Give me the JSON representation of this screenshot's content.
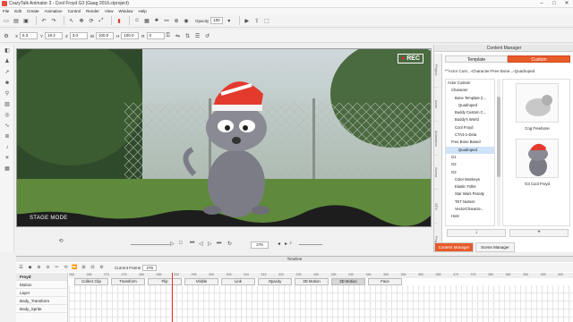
{
  "window": {
    "title": "CrazyTalk Animator 3 - Cool Froyd G3 (Gaag 2016.ctproject)"
  },
  "menu": [
    "File",
    "Edit",
    "Create",
    "Animation",
    "Control",
    "Render",
    "View",
    "Window",
    "Help"
  ],
  "toolbar": {
    "opacity_label": "Opacity",
    "opacity_value": "100"
  },
  "transform": {
    "x_label": "X",
    "x_value": "6.3",
    "y_label": "Y",
    "y_value": "19.2",
    "z_label": "Z",
    "z_value": "3.0",
    "w_label": "W",
    "w_value": "100.0",
    "h_label": "H",
    "h_value": "100.0",
    "r_label": "R",
    "r_value": "0"
  },
  "stage": {
    "rec_label": "REC",
    "mode_label": "STAGE MODE"
  },
  "playback": {
    "current_frame": "276"
  },
  "content_manager": {
    "title": "Content Manager",
    "tabs": [
      "Template",
      "Custom"
    ],
    "active_tab": "Custom",
    "side_tabs": [
      "Project",
      "Actor",
      "Animation",
      "Scene",
      "SFX",
      "Prop"
    ],
    "path": [
      "Actor Cust...",
      "Character",
      "Free Bone...",
      "Quadruped"
    ],
    "tree": [
      {
        "label": "Actor Custom",
        "indent": 0
      },
      {
        "label": "Character",
        "indent": 1
      },
      {
        "label": "Bone Template (I...",
        "indent": 2
      },
      {
        "label": "Quadruped",
        "indent": 3
      },
      {
        "label": "Buddy Custom C...",
        "indent": 2
      },
      {
        "label": "Buddy's World",
        "indent": 2
      },
      {
        "label": "Cool Froyd",
        "indent": 2
      },
      {
        "label": "CTA3-1-Deta",
        "indent": 2
      },
      {
        "label": "Free Bone Based",
        "indent": 1
      },
      {
        "label": "Quadruped",
        "indent": 3,
        "selected": true
      },
      {
        "label": "G1",
        "indent": 1
      },
      {
        "label": "G2",
        "indent": 1
      },
      {
        "label": "G3",
        "indent": 1
      },
      {
        "label": "Color Monkeys",
        "indent": 2
      },
      {
        "label": "Elastic Folks",
        "indent": 2
      },
      {
        "label": "Star Wars Parody",
        "indent": 2
      },
      {
        "label": "TET Nutters",
        "indent": 2
      },
      {
        "label": "VectorCharacte...",
        "indent": 2
      },
      {
        "label": "Host",
        "indent": 1
      }
    ],
    "thumbnails": [
      {
        "caption": "Cog Freebone"
      },
      {
        "caption": "G3 Cool Froyd"
      }
    ],
    "bottom_tabs": [
      "Content Manager",
      "Scene Manager"
    ],
    "active_bottom_tab": "Content Manager"
  },
  "timeline": {
    "title": "Timeline",
    "current_frame_label": "Current Frame",
    "current_frame_value": "276",
    "ruler_ticks": [
      "260",
      "265",
      "270",
      "275",
      "280",
      "285",
      "290",
      "295",
      "300",
      "305",
      "310",
      "315",
      "320",
      "325",
      "330",
      "335",
      "340",
      "345",
      "350",
      "355",
      "360",
      "365",
      "370",
      "375",
      "380",
      "385",
      "390",
      "395",
      "400"
    ],
    "track_headers": [
      "Collect Clip",
      "Transform",
      "Flip",
      "Visible",
      "Link",
      "Opacity",
      "3D Motion",
      "3D Motion",
      "Face"
    ],
    "active_track_header": "3D Motion",
    "track_names": [
      "Froyd",
      "Motion",
      "Layer",
      "Body_Transform",
      "Body_Sprite"
    ]
  },
  "colors": {
    "accent": "#e85b2a",
    "rec_dot": "#e22222",
    "playhead": "#e33333"
  }
}
